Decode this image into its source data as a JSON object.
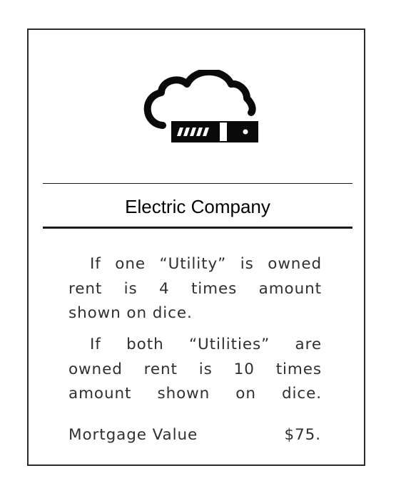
{
  "card": {
    "title": "Electric Company",
    "icon": "cloud-server-icon",
    "rent_one_utility_lines": [
      "If one “Utility” is owned",
      "rent is 4 times amount",
      "shown on dice."
    ],
    "rent_both_utilities_lines": [
      "If both “Utilities” are",
      "owned rent is 10 times",
      "amount shown on dice."
    ],
    "mortgage_label": "Mortgage Value",
    "mortgage_value": "$75."
  }
}
